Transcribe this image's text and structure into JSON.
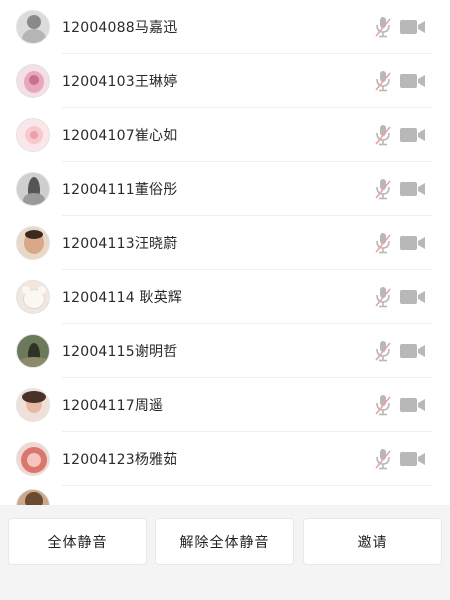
{
  "participants": [
    {
      "name": "12004088马嘉迅"
    },
    {
      "name": "12004103王琳婷"
    },
    {
      "name": "12004107崔心如"
    },
    {
      "name": "12004111董俗彤"
    },
    {
      "name": "12004113汪晓蔚"
    },
    {
      "name": "12004114 耿英辉"
    },
    {
      "name": "12004115谢明哲"
    },
    {
      "name": "12004117周遥"
    },
    {
      "name": "12004123杨雅茹"
    }
  ],
  "icons": {
    "mic": "mic-muted-icon",
    "camera": "video-camera-icon"
  },
  "colors": {
    "icon_gray": "#b8b8b8",
    "slash_red": "#e7a3a3",
    "background": "#ffffff",
    "bar_background": "#f4f4f4"
  },
  "buttons": {
    "mute_all": "全体静音",
    "unmute_all": "解除全体静音",
    "invite": "邀请"
  }
}
